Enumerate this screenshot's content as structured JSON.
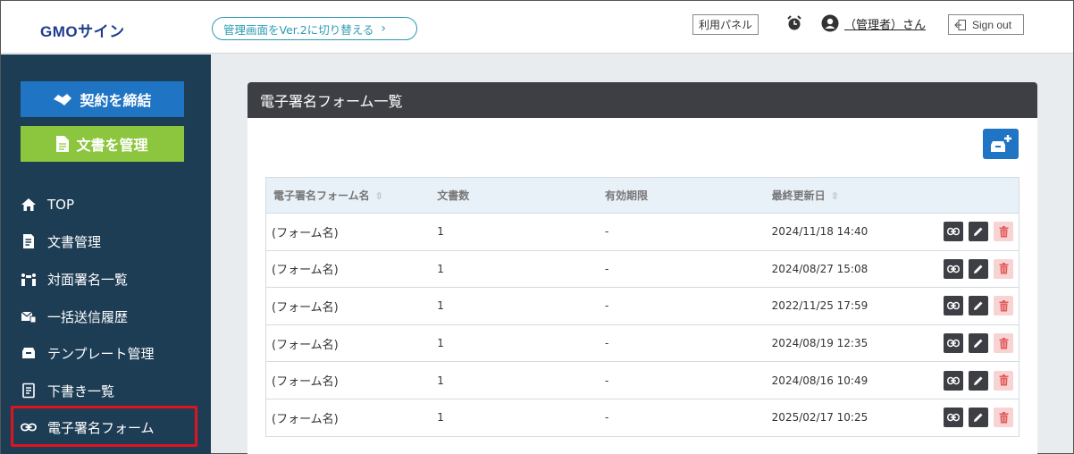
{
  "header": {
    "logo": "GMOサイン",
    "switch_version": "管理画面をVer.2に切り替える",
    "panel_button": "利用パネル",
    "user_name": "（管理者）さん",
    "signout": "Sign out"
  },
  "sidebar": {
    "contract_button": "契約を締結",
    "docs_button": "文書を管理",
    "items": [
      {
        "label": "TOP",
        "icon": "home-icon"
      },
      {
        "label": "文書管理",
        "icon": "document-icon"
      },
      {
        "label": "対面署名一覧",
        "icon": "face-to-face-icon"
      },
      {
        "label": "一括送信履歴",
        "icon": "bulk-send-icon"
      },
      {
        "label": "テンプレート管理",
        "icon": "template-icon"
      },
      {
        "label": "下書き一覧",
        "icon": "draft-icon"
      },
      {
        "label": "電子署名フォーム",
        "icon": "link-icon"
      }
    ],
    "active_item": "電子署名フォーム"
  },
  "main": {
    "title": "電子署名フォーム一覧",
    "columns": [
      "電子署名フォーム名",
      "文書数",
      "有効期限",
      "最終更新日",
      ""
    ],
    "rows": [
      {
        "name": "(フォーム名)",
        "count": "1",
        "expiry": "-",
        "updated": "2024/11/18 14:40"
      },
      {
        "name": "(フォーム名)",
        "count": "1",
        "expiry": "-",
        "updated": "2024/08/27 15:08"
      },
      {
        "name": "(フォーム名)",
        "count": "1",
        "expiry": "-",
        "updated": "2022/11/25 17:59"
      },
      {
        "name": "(フォーム名)",
        "count": "1",
        "expiry": "-",
        "updated": "2024/08/19 12:35"
      },
      {
        "name": "(フォーム名)",
        "count": "1",
        "expiry": "-",
        "updated": "2024/08/16 10:49"
      },
      {
        "name": "(フォーム名)",
        "count": "1",
        "expiry": "-",
        "updated": "2025/02/17 10:25"
      }
    ]
  },
  "colors": {
    "sidebar_bg": "#1d3d55",
    "primary": "#1f74c4",
    "green": "#8cc63f",
    "header_dark": "#3d3f44",
    "active_border": "#e0141e",
    "delete_bg": "#f8d3d3",
    "delete_icon": "#e35b5b"
  }
}
